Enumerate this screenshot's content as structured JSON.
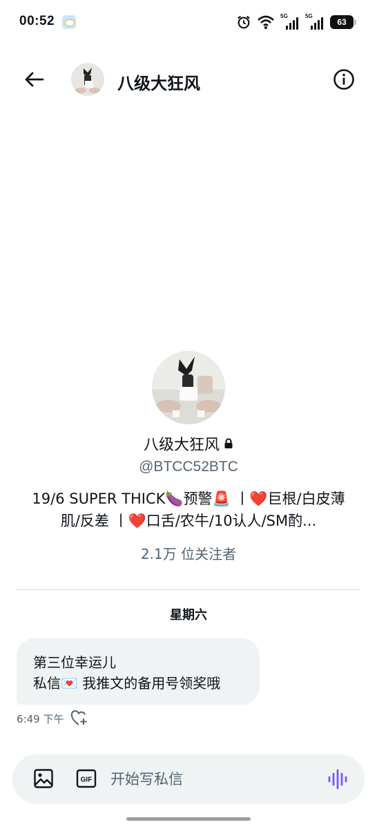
{
  "status_bar": {
    "time": "00:52",
    "network_label_1": "5G",
    "network_label_2": "5G",
    "battery": "63"
  },
  "header": {
    "title": "八级大狂风",
    "back_icon": "arrow-left-icon",
    "info_icon": "info-circle-icon"
  },
  "profile": {
    "name": "八级大狂风",
    "handle": "@BTCC52BTC",
    "bio": "19/6 SUPER THICK🍆预警🚨 丨❤️巨根/白皮薄肌/反差 丨❤️口舌/农牛/10认人/SM酌...",
    "followers": "2.1万 位关注者"
  },
  "conversation": {
    "day_label": "星期六",
    "message": {
      "line1": "第三位幸运儿",
      "line2": "私信💌 我推文的备用号领奖哦",
      "time": "6:49 下午"
    }
  },
  "composer": {
    "placeholder": "开始写私信",
    "gif_label": "GIF",
    "accent_color": "#7856ff"
  }
}
